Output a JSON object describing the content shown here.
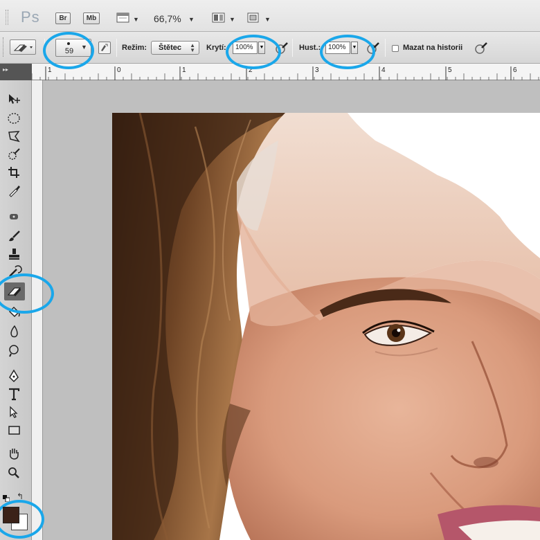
{
  "app": {
    "logo": "Ps",
    "bridge_label": "Br",
    "minibridge_label": "Mb",
    "zoom": "66,7%"
  },
  "options": {
    "brush_size": "59",
    "mode_label": "Režim:",
    "mode_value": "Štětec",
    "opacity_label": "Krytí:",
    "opacity_value": "100%",
    "flow_label": "Hust.:",
    "flow_value": "100%",
    "erase_history_label": "Mazat na historii",
    "erase_history_checked": false
  },
  "ruler": {
    "marks": [
      "1",
      "0",
      "1",
      "2",
      "3",
      "4",
      "5",
      "6"
    ]
  },
  "toolbox": {
    "tools": [
      "move-tool-icon",
      "marquee-tool-icon",
      "lasso-tool-icon",
      "quick-select-tool-icon",
      "crop-tool-icon",
      "eyedropper-tool-icon",
      "healing-brush-tool-icon",
      "brush-tool-icon",
      "clone-stamp-tool-icon",
      "history-brush-tool-icon",
      "eraser-tool-icon",
      "paint-bucket-tool-icon",
      "blur-tool-icon",
      "dodge-tool-icon",
      "pen-tool-icon",
      "type-tool-icon",
      "path-select-tool-icon",
      "rectangle-tool-icon",
      "hand-tool-icon",
      "zoom-tool-icon"
    ],
    "active_tool": "eraser-tool-icon",
    "foreground_color": "#3b2218",
    "background_color": "#ffffff"
  },
  "annotation": {
    "ring_color": "#1aa7ea"
  }
}
